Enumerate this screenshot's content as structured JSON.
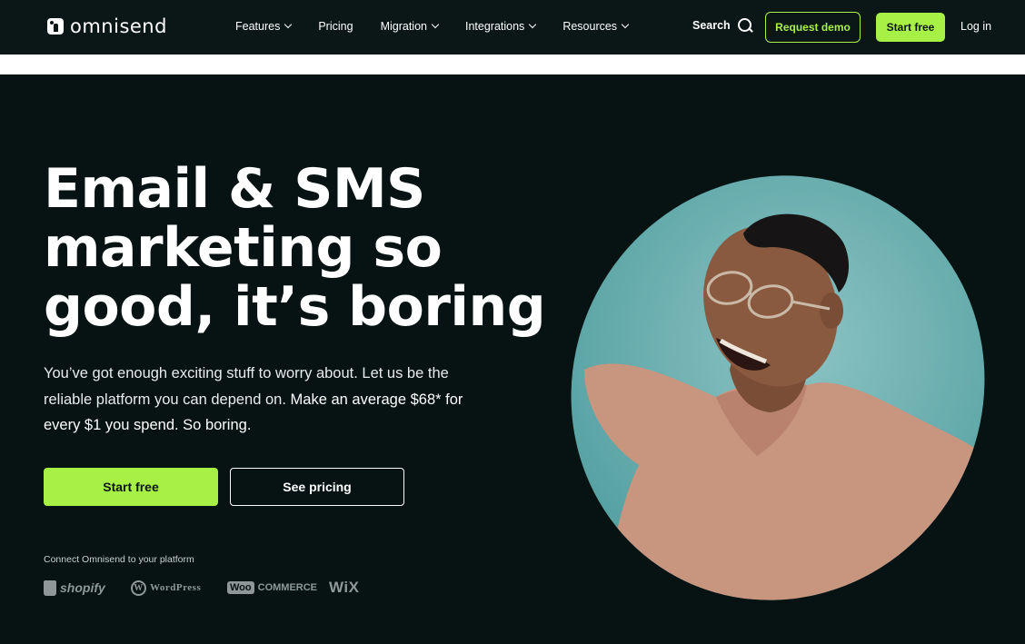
{
  "nav": {
    "logo_text": "omnisend",
    "menu": [
      {
        "label": "Features",
        "has_dropdown": true
      },
      {
        "label": "Pricing",
        "has_dropdown": false
      },
      {
        "label": "Migration",
        "has_dropdown": true
      },
      {
        "label": "Integrations",
        "has_dropdown": true
      },
      {
        "label": "Resources",
        "has_dropdown": true
      }
    ],
    "search_label": "Search",
    "request_demo": "Request demo",
    "start_free": "Start free",
    "login": "Log in"
  },
  "hero": {
    "headline_line1": "Email & SMS",
    "headline_line2": "marketing so",
    "headline_line3": "good, it’s boring",
    "sub_part1": "You’ve got enough exciting stuff to worry about. Let us be the reliable platform you can depend on.",
    "sub_part2": "Make an average $68* for every $1 you spend. So boring.",
    "primary_cta": "Start free",
    "secondary_cta": "See pricing",
    "connect_label": "Connect Omnisend to your platform",
    "platforms": [
      {
        "name": "shopify"
      },
      {
        "name": "WordPress"
      },
      {
        "name": "COMMERCE",
        "badge": "Woo"
      },
      {
        "name": "WiX"
      }
    ]
  },
  "colors": {
    "accent": "#a7f046",
    "background": "#061312",
    "photo_bg": "#5fa8a8",
    "sweater": "#c8957f"
  }
}
